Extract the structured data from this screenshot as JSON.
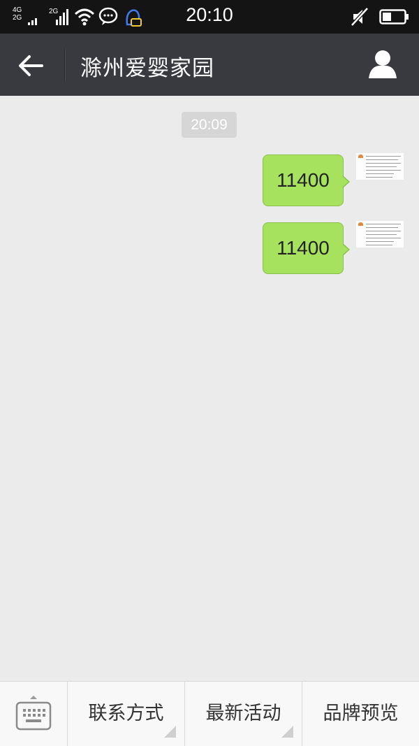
{
  "status_bar": {
    "network_top": "4G",
    "network_bottom": "2G",
    "network2": "2G",
    "time": "20:10"
  },
  "header": {
    "title": "滁州爱婴家园"
  },
  "chat": {
    "timestamp": "20:09",
    "messages": [
      {
        "text": "11400"
      },
      {
        "text": "11400"
      }
    ]
  },
  "bottom_menu": {
    "items": [
      {
        "label": "联系方式"
      },
      {
        "label": "最新活动"
      },
      {
        "label": "品牌预览"
      }
    ]
  },
  "colors": {
    "bubble": "#a7e25e",
    "header_bg": "#393a3f",
    "chat_bg": "#ebebeb"
  }
}
